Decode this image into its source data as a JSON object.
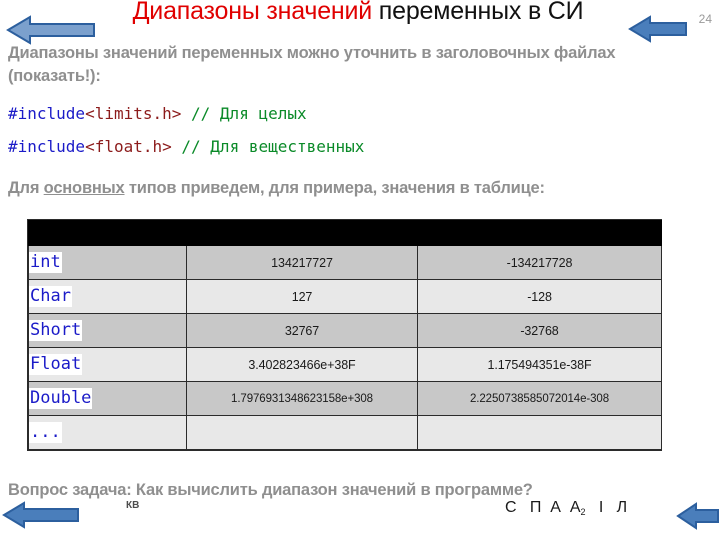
{
  "slide": {
    "page_number": "24",
    "watermark": "КВ",
    "title": {
      "highlight": "Диапазоны значений",
      "rest": " переменных в СИ"
    },
    "paragraph_1": "Диапазоны значений переменных можно уточнить в заголовочных файлах (показать!):",
    "paragraph_2": {
      "before": "Для ",
      "underlined": "основных",
      "after": " типов приведем, для примера, значения в таблице:"
    },
    "paragraph_3": "Вопрос задача: Как вычислить диапазон значений в программе?",
    "code_lines": [
      {
        "keyword": "#include",
        "header": "<limits.h>",
        "comment": " // Для целых"
      },
      {
        "keyword": "#include",
        "header": "<float.h>",
        "comment": " // Для вещественных"
      }
    ],
    "footer_letters": {
      "glyphs": "С   П  А  А",
      "subscript": "2",
      "tail": "   І   Л"
    },
    "arrows": [
      {
        "name": "arrow-top-left",
        "direction": "left",
        "fill": "#7ba0cd",
        "stroke": "#2c5f9e"
      },
      {
        "name": "arrow-top-right",
        "direction": "left",
        "fill": "#4a7ebb",
        "stroke": "#2c5f9e"
      },
      {
        "name": "arrow-bottom-left",
        "direction": "left",
        "fill": "#4a7ebb",
        "stroke": "#2c5f9e"
      },
      {
        "name": "arrow-bottom-right",
        "direction": "left",
        "fill": "#4a7ebb",
        "stroke": "#2c5f9e"
      }
    ],
    "colors": {
      "title_highlight": "#e00000",
      "title_rest": "#111111",
      "body_text": "#8f8f8f",
      "code_keyword": "#1b1bc8",
      "code_header": "#8c1b1b",
      "code_comment": "#0a8a28",
      "table_header_bg": "#000000",
      "row_shade_dark": "#c8c8c8",
      "row_shade_light": "#e8e8e8",
      "type_text": "#1b1bc8"
    }
  },
  "table": {
    "headers": [
      "",
      "",
      ""
    ],
    "rows": [
      {
        "type": "int",
        "max": "134217727",
        "min": "-134217728"
      },
      {
        "type": "Char",
        "max": "127",
        "min": "-128"
      },
      {
        "type": "Short",
        "max": "32767",
        "min": "-32768"
      },
      {
        "type": "Float",
        "max": "3.402823466e+38F",
        "min": "1.175494351e-38F"
      },
      {
        "type": "Double",
        "max": "1.7976931348623158e+308",
        "min": "2.2250738585072014e-308"
      },
      {
        "type": "...",
        "max": "",
        "min": ""
      }
    ]
  }
}
